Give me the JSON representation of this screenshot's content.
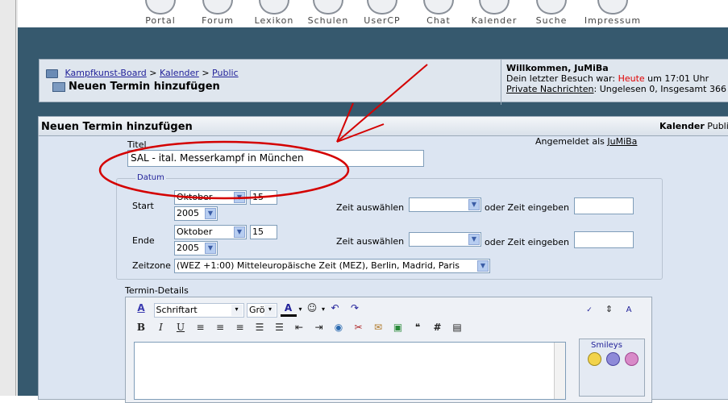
{
  "nav": {
    "items": [
      {
        "label": "Portal",
        "icon": "portal-icon"
      },
      {
        "label": "Forum",
        "icon": "forum-icon"
      },
      {
        "label": "Lexikon",
        "icon": "lexikon-icon"
      },
      {
        "label": "Schulen",
        "icon": "schulen-icon"
      },
      {
        "label": "UserCP",
        "icon": "usercp-icon"
      },
      {
        "label": "Chat",
        "icon": "chat-icon"
      },
      {
        "label": "Kalender",
        "icon": "kalender-icon"
      },
      {
        "label": "Suche",
        "icon": "suche-icon"
      },
      {
        "label": "Impressum",
        "icon": "impressum-icon"
      }
    ]
  },
  "breadcrumb": {
    "home": "Kampfkunst-Board",
    "sep": ">",
    "calendar": "Kalender",
    "public": "Public",
    "current": "Neuen Termin hinzufügen"
  },
  "welcome": {
    "title": "Willkommen, JuMiBa",
    "visit_prefix": "Dein letzter Besuch war:",
    "visit_day": "Heute",
    "visit_suffix": "um 17:01 Uhr",
    "pm_link": "Private Nachrichten",
    "pm_text": ": Ungelesen 0, Insgesamt 366"
  },
  "form": {
    "header": "Neuen Termin hinzufügen",
    "header_right_bold": "Kalender",
    "header_right": "Public",
    "logged_in_prefix": "Angemeldet als",
    "logged_in_user": "JuMiBa",
    "title_label": "Titel",
    "title_value": "SAL - ital. Messerkampf in München",
    "date_legend": "Datum",
    "start_label": "Start",
    "end_label": "Ende",
    "month_value": "Oktober",
    "day_value": "15",
    "year_value": "2005",
    "time_choose_label": "Zeit auswählen",
    "time_enter_label": "oder Zeit eingeben",
    "timezone_label": "Zeitzone",
    "timezone_value": "(WEZ +1:00) Mitteleuropäische Zeit (MEZ), Berlin, Madrid, Paris",
    "details_label": "Termin-Details"
  },
  "editor": {
    "font_value": "Schriftart",
    "size_value": "Größ",
    "smileys_label": "Smileys"
  },
  "colors": {
    "band": "#36596e",
    "form_bg": "#dce5f2",
    "annotation": "#d40000"
  }
}
